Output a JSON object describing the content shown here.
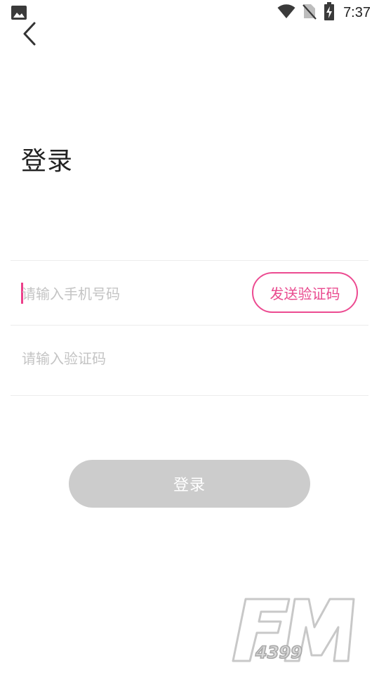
{
  "status_bar": {
    "time": "7:37",
    "icons": [
      "image-icon",
      "wifi-icon",
      "no-sim-icon",
      "battery-charging-icon"
    ]
  },
  "header": {
    "back_icon": "chevron-left-icon"
  },
  "page": {
    "title": "登录"
  },
  "form": {
    "phone_placeholder": "请输入手机号码",
    "phone_value": "",
    "send_code_label": "发送验证码",
    "code_placeholder": "请输入验证码",
    "code_value": ""
  },
  "actions": {
    "login_label": "登录"
  },
  "watermark": {
    "text": "FM 4399"
  },
  "colors": {
    "accent": "#ec4b91",
    "button_disabled": "#cccccc",
    "divider": "#ececec",
    "placeholder": "#c4c4c4"
  }
}
